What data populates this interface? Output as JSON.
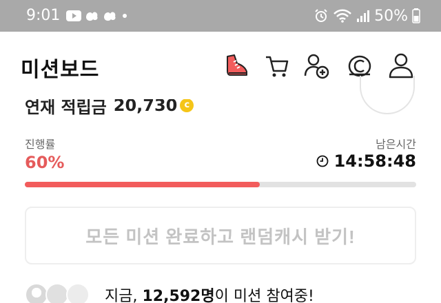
{
  "status_bar": {
    "time": "9:01",
    "battery": "50%",
    "left_icons": [
      "youtube-icon",
      "cloud-check-icon",
      "cloud-check-icon",
      "dot-icon"
    ],
    "right_icons": [
      "alarm-icon",
      "wifi-icon",
      "signal-icon",
      "battery-icon"
    ]
  },
  "header": {
    "title": "미션보드",
    "icons": [
      "sneaker-icon",
      "cart-icon",
      "add-friend-icon",
      "coin-c-icon",
      "profile-icon"
    ]
  },
  "earned": {
    "label": "연재 적립금",
    "amount": "20,730",
    "coin_symbol": "c"
  },
  "progress": {
    "label": "진행률",
    "value": "60%",
    "fraction": 0.6
  },
  "remaining": {
    "label": "남은시간",
    "value": "14:58:48"
  },
  "random_cash_button": {
    "label": "모든 미션 완료하고 랜덤캐시 받기!"
  },
  "participants": {
    "prefix": "지금, ",
    "count": "12,592명",
    "suffix": "이 미션 참여중!"
  },
  "colors": {
    "accent": "#f25c5c",
    "progress_text": "#e55b5b",
    "coin": "#f5c518",
    "status_bar": "#a9a9a9"
  }
}
